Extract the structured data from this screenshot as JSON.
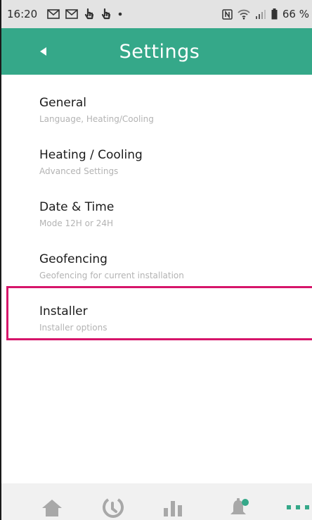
{
  "status_bar": {
    "time": "16:20",
    "battery_text": "66 %",
    "left_icons": [
      "gmail-icon",
      "gmail-icon",
      "touch-icon",
      "touch-icon",
      "dot-icon"
    ],
    "right_icons": [
      "nfc-icon",
      "wifi-icon",
      "signal-icon",
      "battery-icon"
    ]
  },
  "header": {
    "title": "Settings",
    "background_color": "#35a889",
    "back_icon": "back-arrow-icon"
  },
  "settings": {
    "items": [
      {
        "title": "General",
        "subtitle": "Language, Heating/Cooling"
      },
      {
        "title": "Heating / Cooling",
        "subtitle": "Advanced Settings"
      },
      {
        "title": "Date & Time",
        "subtitle": "Mode 12H or 24H"
      },
      {
        "title": "Geofencing",
        "subtitle": "Geofencing for current installation"
      },
      {
        "title": "Installer",
        "subtitle": "Installer options",
        "highlighted": true
      }
    ]
  },
  "highlight": {
    "color": "#d6156a",
    "target": "Installer"
  },
  "bottom_nav": {
    "items": [
      {
        "icon": "home-icon"
      },
      {
        "icon": "schedule-icon"
      },
      {
        "icon": "stats-icon"
      },
      {
        "icon": "notifications-icon",
        "badge": true
      },
      {
        "icon": "more-icon",
        "active": true
      }
    ],
    "icon_color": "#a8a8a8",
    "accent_color": "#35a889"
  }
}
